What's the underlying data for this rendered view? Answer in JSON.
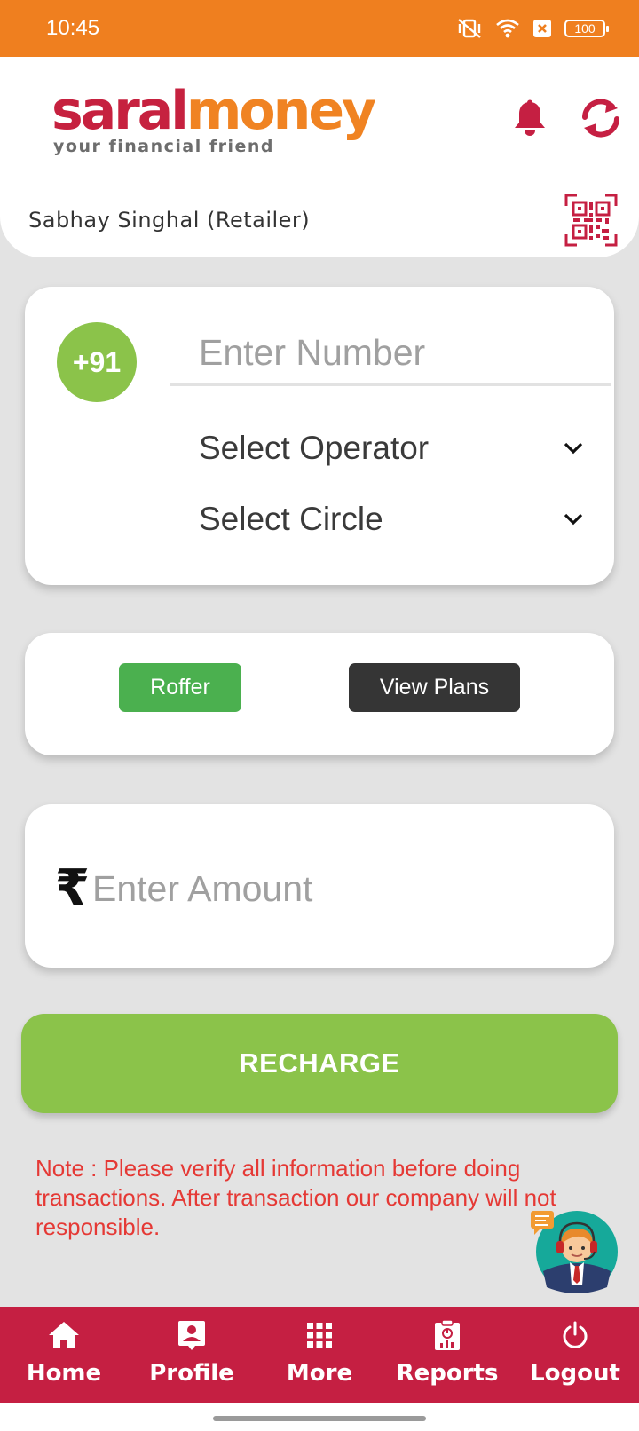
{
  "status_bar": {
    "time": "10:45",
    "battery": "100"
  },
  "header": {
    "logo_part1": "saral",
    "logo_part2": "money",
    "tagline": "your financial friend",
    "user_name": "Sabhay Singhal (Retailer)"
  },
  "number_card": {
    "country_code": "+91",
    "number_placeholder": "Enter Number",
    "operator_label": "Select Operator",
    "circle_label": "Select Circle"
  },
  "plans_card": {
    "roffer_label": "Roffer",
    "view_plans_label": "View Plans"
  },
  "amount_card": {
    "currency_symbol": "₹",
    "amount_placeholder": "Enter Amount"
  },
  "recharge_label": "RECHARGE",
  "note": "Note : Please verify all information before doing transactions. After transaction our company will not responsible.",
  "bottom_nav": {
    "items": [
      {
        "label": "Home",
        "icon": "home-icon"
      },
      {
        "label": "Profile",
        "icon": "profile-icon"
      },
      {
        "label": "More",
        "icon": "grid-icon"
      },
      {
        "label": "Reports",
        "icon": "reports-icon"
      },
      {
        "label": "Logout",
        "icon": "power-icon"
      }
    ]
  },
  "colors": {
    "status_bar": "#ef7f1f",
    "brand_red": "#c51f42",
    "brand_orange": "#f08322",
    "green": "#8bc34a",
    "note_red": "#e53935"
  }
}
